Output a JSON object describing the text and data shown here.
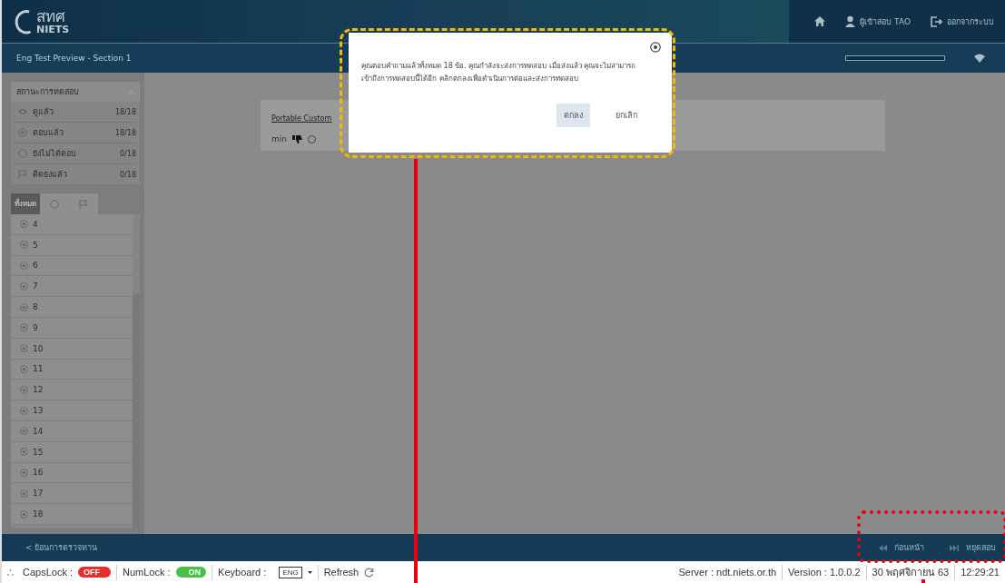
{
  "header": {
    "logo_thai": "สทศ",
    "logo_latin": "NIETS",
    "user": "ผู้เข้าสอบ TAO",
    "logout": "ออกจากระบบ"
  },
  "subheader": {
    "title": "Eng Test Preview - Section 1",
    "level": 0
  },
  "status_panel": {
    "title": "สถานะการทดสอบ",
    "expanded": true,
    "rows": [
      {
        "kind": "viewed",
        "label": "ดูแล้ว",
        "count": "18/18"
      },
      {
        "kind": "answered",
        "label": "ตอบแล้ว",
        "count": "18/18"
      },
      {
        "kind": "unanswered",
        "label": "ยังไม่ได้ตอบ",
        "count": "0/18"
      },
      {
        "kind": "flagged",
        "label": "ติดธงแล้ว",
        "count": "0/18"
      }
    ]
  },
  "filter_tabs": [
    {
      "kind": "all",
      "label": "ทั้งหมด",
      "selected": true
    },
    {
      "kind": "unanswered",
      "selected": false
    },
    {
      "kind": "flagged",
      "selected": false
    }
  ],
  "questions": [
    {
      "label": "4",
      "answered": true
    },
    {
      "label": "5",
      "answered": true
    },
    {
      "label": "6",
      "answered": true
    },
    {
      "label": "7",
      "answered": true
    },
    {
      "label": "8",
      "answered": true
    },
    {
      "label": "9",
      "answered": true
    },
    {
      "label": "10",
      "answered": true
    },
    {
      "label": "11",
      "answered": true
    },
    {
      "label": "12",
      "answered": true
    },
    {
      "label": "13",
      "answered": true
    },
    {
      "label": "14",
      "answered": true
    },
    {
      "label": "15",
      "answered": true
    },
    {
      "label": "16",
      "answered": true
    },
    {
      "label": "17",
      "answered": true
    },
    {
      "label": "18",
      "answered": true
    }
  ],
  "question_card": {
    "title": "Portable Custom",
    "scale_label": "min",
    "rating_selected": false
  },
  "dialog": {
    "message": "คุณตอบคำถามแล้วทั้งหมด 18 ข้อ. คุณกำลังจะส่งการทดสอบ เมื่อส่งแล้ว คุณจะไม่สามารถเข้าถึงการทดสอบนี้ได้อีก คลิกตกลงเพื่อดำเนินการต่อและส่งการทดสอบ",
    "buttons": [
      {
        "label": "ตกลง",
        "primary": true
      },
      {
        "label": "ยกเลิก",
        "primary": false
      }
    ]
  },
  "footer_nav": {
    "back": "< ย้อนการตรวจทาน",
    "previous": "ก่อนหน้า",
    "next": "หยุดสอบ"
  },
  "status_bar": {
    "capslock_label": "CapsLock :",
    "capslock": {
      "on": false,
      "text": "OFF"
    },
    "numlock_label": "NumLock :",
    "numlock": {
      "on": true,
      "text": "ON"
    },
    "keyboard_label": "Keyboard :",
    "keyboard": "ENG",
    "refresh": "Refresh",
    "server": "Server : ndt.niets.or.th",
    "version": "Version : 1.0.0.2",
    "date": "30 พฤศจิกายน 63",
    "time": "12:29:21"
  }
}
